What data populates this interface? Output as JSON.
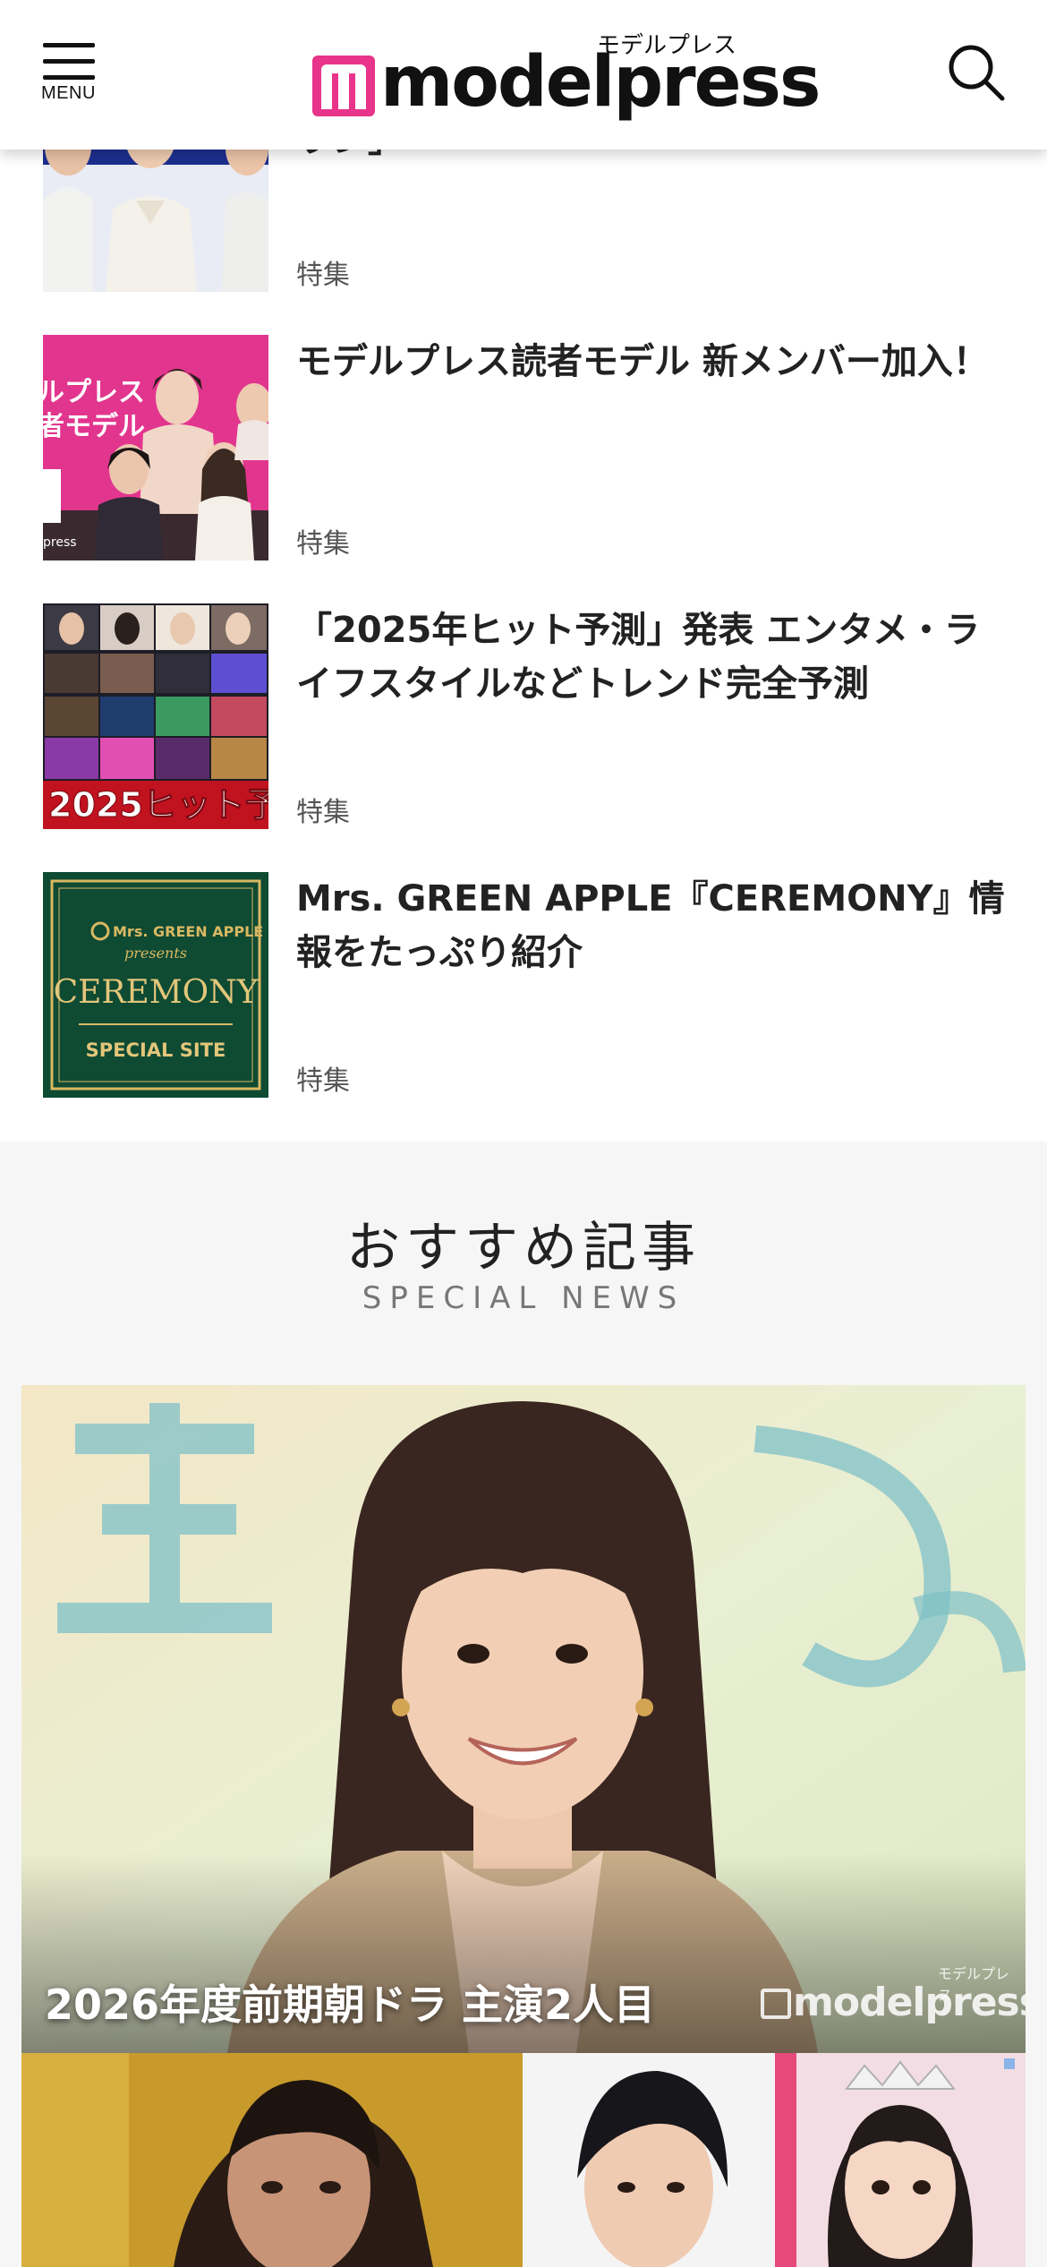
{
  "header": {
    "menu_label": "MENU",
    "logo_sub": "モデルプレス",
    "logo_text": "modelpress"
  },
  "articles": [
    {
      "title": "ウン」",
      "tag": "特集"
    },
    {
      "title": "モデルプレス読者モデル 新メンバー加入！",
      "tag": "特集"
    },
    {
      "title": "「2025年ヒット予測」発表 エンタメ・ライフスタイルなどトレンド完全予測",
      "tag": "特集"
    },
    {
      "title": "Mrs. GREEN APPLE『CEREMONY』情報をたっぷり紹介",
      "tag": "特集"
    }
  ],
  "thumb_text": {
    "readers_1": "ルプレス",
    "readers_2": "者モデル",
    "readers_3": "press",
    "hit_banner": "2025ヒット予",
    "ceremony_top": "Mrs. GREEN APPLE",
    "ceremony_presents": "presents",
    "ceremony_title": "CEREMONY",
    "ceremony_site": "SPECIAL SITE"
  },
  "recommend": {
    "title": "おすすめ記事",
    "subtitle": "SPECIAL NEWS",
    "hero_caption": "2026年度前期朝ドラ 主演2人目",
    "watermark_sub": "モデルプレス",
    "watermark_text": "modelpress"
  },
  "colors": {
    "brand_pink": "#e8348b",
    "section_bg": "#f6f6f6",
    "ceremony_green": "#0f4a33",
    "ceremony_gold": "#d8b862"
  }
}
